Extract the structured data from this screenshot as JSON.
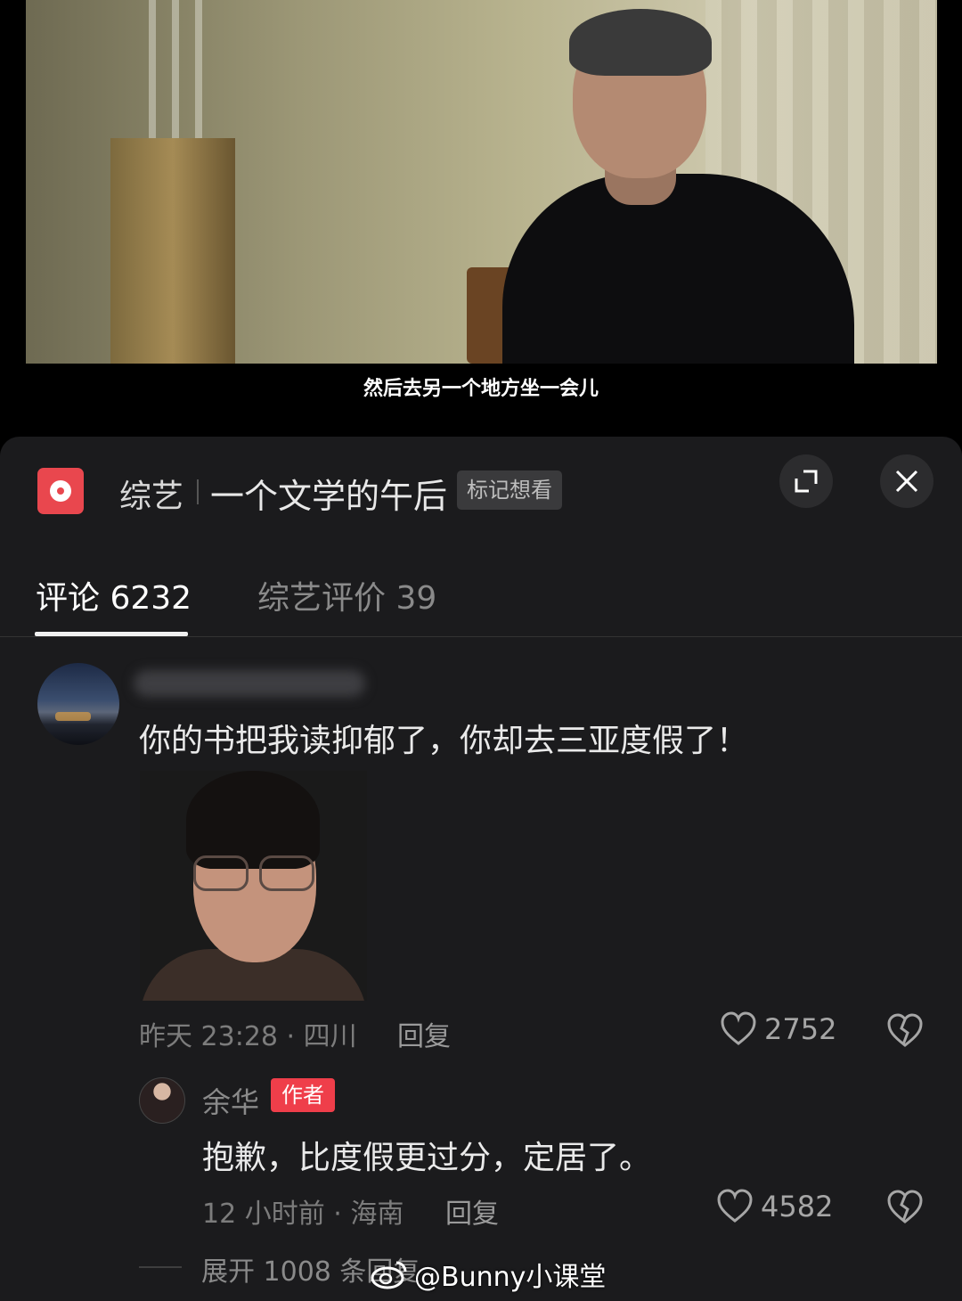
{
  "video": {
    "subtitle": "然后去另一个地方坐一会儿"
  },
  "header": {
    "app_icon": "video-app-icon",
    "category": "综艺",
    "title": "一个文学的午后",
    "mark_button": "标记想看",
    "expand_icon": "expand-icon",
    "close_icon": "close-icon",
    "brand_color": "#e9474e"
  },
  "tabs": [
    {
      "label": "评论 6232",
      "active": true
    },
    {
      "label": "综艺评价 39",
      "active": false
    }
  ],
  "comment": {
    "text": "你的书把我读抑郁了，你却去三亚度假了！",
    "time_location": "昨天 23:28 · 四川",
    "reply_label": "回复",
    "likes": "2752"
  },
  "reply": {
    "author": "余华",
    "badge": "作者",
    "badge_color": "#ef3e4a",
    "text": "抱歉，比度假更过分，定居了。",
    "time_location": "12 小时前 · 海南",
    "reply_label": "回复",
    "likes": "4582"
  },
  "expand_replies": "展开 1008 条回复",
  "watermark": "@Bunny小课堂"
}
